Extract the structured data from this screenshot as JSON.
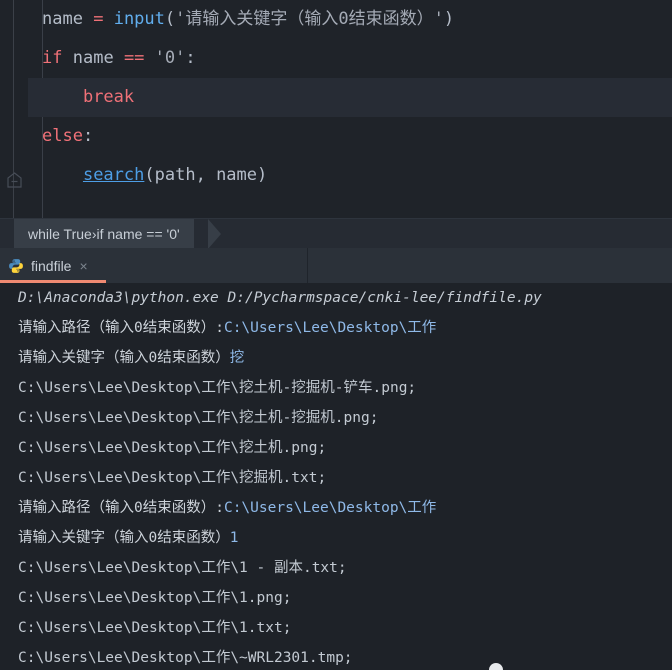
{
  "editor": {
    "lines": [
      {
        "id": "line-name-input",
        "parts": [
          {
            "t": "name",
            "c": "var"
          },
          {
            "t": " ",
            "c": "plain"
          },
          {
            "t": "=",
            "c": "op"
          },
          {
            "t": " ",
            "c": "plain"
          },
          {
            "t": "input",
            "c": "fn"
          },
          {
            "t": "(",
            "c": "punct"
          },
          {
            "t": "'请输入关键字（输入0结束函数）'",
            "c": "strlit"
          },
          {
            "t": ")",
            "c": "punct"
          }
        ],
        "indent": 0,
        "highlight": false
      },
      {
        "id": "line-if",
        "parts": [
          {
            "t": "if",
            "c": "kw"
          },
          {
            "t": " ",
            "c": "plain"
          },
          {
            "t": "name",
            "c": "var"
          },
          {
            "t": " ",
            "c": "plain"
          },
          {
            "t": "==",
            "c": "op"
          },
          {
            "t": " ",
            "c": "plain"
          },
          {
            "t": "'0'",
            "c": "strlit"
          },
          {
            "t": ":",
            "c": "punct"
          }
        ],
        "indent": 0,
        "highlight": false
      },
      {
        "id": "line-break",
        "parts": [
          {
            "t": "    ",
            "c": "plain"
          },
          {
            "t": "break",
            "c": "kw"
          }
        ],
        "indent": 1,
        "highlight": true
      },
      {
        "id": "line-else",
        "parts": [
          {
            "t": "else",
            "c": "kw"
          },
          {
            "t": ":",
            "c": "punct"
          }
        ],
        "indent": 0,
        "highlight": false
      },
      {
        "id": "line-search-call",
        "parts": [
          {
            "t": "    ",
            "c": "plain"
          },
          {
            "t": "search",
            "c": "link"
          },
          {
            "t": "(",
            "c": "punct"
          },
          {
            "t": "path",
            "c": "var"
          },
          {
            "t": ", ",
            "c": "punct"
          },
          {
            "t": "name",
            "c": "var"
          },
          {
            "t": ")",
            "c": "punct"
          }
        ],
        "indent": 1,
        "highlight": false
      }
    ]
  },
  "breadcrumb": {
    "items": [
      "while True",
      "if name == '0'"
    ],
    "separator": "›"
  },
  "tabbar": {
    "tab": {
      "label": "findfile",
      "icon": "python-file-icon",
      "close": "×",
      "active_color": "#f08a72"
    }
  },
  "console": {
    "lines": [
      {
        "id": "console-command",
        "style": "cmd",
        "segments": [
          {
            "t": "D:\\Anaconda3\\python.exe D:/Pycharmspace/cnki-lee/findfile.py",
            "c": "cmd"
          }
        ]
      },
      {
        "id": "console-prompt-path-1",
        "style": "out",
        "segments": [
          {
            "t": "请输入路径（输入0结束函数）:",
            "c": "out"
          },
          {
            "t": "C:\\Users\\Lee\\Desktop\\工作",
            "c": "inp"
          }
        ]
      },
      {
        "id": "console-prompt-keyword-1",
        "style": "out",
        "segments": [
          {
            "t": "请输入关键字（输入0结束函数）",
            "c": "out"
          },
          {
            "t": "挖",
            "c": "inp"
          }
        ]
      },
      {
        "id": "console-result-1",
        "style": "path",
        "segments": [
          {
            "t": "C:\\Users\\Lee\\Desktop\\工作\\挖土机-挖掘机-铲车.png;",
            "c": "path"
          }
        ]
      },
      {
        "id": "console-result-2",
        "style": "path",
        "segments": [
          {
            "t": "C:\\Users\\Lee\\Desktop\\工作\\挖土机-挖掘机.png;",
            "c": "path"
          }
        ]
      },
      {
        "id": "console-result-3",
        "style": "path",
        "segments": [
          {
            "t": "C:\\Users\\Lee\\Desktop\\工作\\挖土机.png;",
            "c": "path"
          }
        ]
      },
      {
        "id": "console-result-4",
        "style": "path",
        "segments": [
          {
            "t": "C:\\Users\\Lee\\Desktop\\工作\\挖掘机.txt;",
            "c": "path"
          }
        ]
      },
      {
        "id": "console-prompt-path-2",
        "style": "out",
        "segments": [
          {
            "t": "请输入路径（输入0结束函数）:",
            "c": "out"
          },
          {
            "t": "C:\\Users\\Lee\\Desktop\\工作",
            "c": "inp"
          }
        ]
      },
      {
        "id": "console-prompt-keyword-2",
        "style": "out",
        "segments": [
          {
            "t": "请输入关键字（输入0结束函数）",
            "c": "out"
          },
          {
            "t": "1",
            "c": "inp"
          }
        ]
      },
      {
        "id": "console-result-5",
        "style": "path",
        "segments": [
          {
            "t": "C:\\Users\\Lee\\Desktop\\工作\\1 - 副本.txt;",
            "c": "path"
          }
        ]
      },
      {
        "id": "console-result-6",
        "style": "path",
        "segments": [
          {
            "t": "C:\\Users\\Lee\\Desktop\\工作\\1.png;",
            "c": "path"
          }
        ]
      },
      {
        "id": "console-result-7",
        "style": "path",
        "segments": [
          {
            "t": "C:\\Users\\Lee\\Desktop\\工作\\1.txt;",
            "c": "path"
          }
        ]
      },
      {
        "id": "console-result-8",
        "style": "path",
        "segments": [
          {
            "t": "C:\\Users\\Lee\\Desktop\\工作\\~WRL2301.tmp;",
            "c": "path"
          }
        ]
      }
    ]
  },
  "colors": {
    "editor_bg": "#1f2329",
    "console_bg": "#1e2228",
    "tabbar_bg": "#2b3139",
    "breadcrumb_bg": "#262b33",
    "crumb_chip_bg": "#373e47",
    "keyword": "#f07178",
    "function": "#61aeee",
    "link": "#4d9ee6",
    "input_echo": "#8fb9e8",
    "tab_active_underline": "#f08a72"
  }
}
